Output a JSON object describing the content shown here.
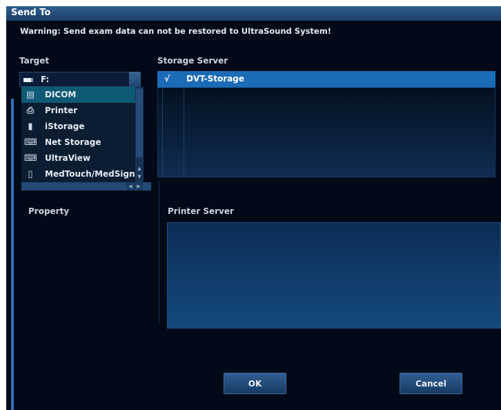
{
  "dialog": {
    "title": "Send To",
    "warning": "Warning: Send exam data can not be restored to UltraSound System!"
  },
  "target": {
    "label": "Target",
    "selected_value": "F:",
    "items": [
      {
        "label": "DICOM",
        "icon": "dicom-icon"
      },
      {
        "label": "Printer",
        "icon": "printer-icon"
      },
      {
        "label": "iStorage",
        "icon": "istorage-icon"
      },
      {
        "label": "Net Storage",
        "icon": "net-storage-icon"
      },
      {
        "label": "UltraView",
        "icon": "ultraview-icon"
      },
      {
        "label": "MedTouch/MedSign",
        "icon": "medtouch-icon"
      }
    ]
  },
  "storage_server": {
    "label": "Storage Server",
    "rows": [
      {
        "check": "√",
        "name": "DVT-Storage"
      }
    ]
  },
  "property": {
    "label": "Property"
  },
  "printer_server": {
    "label": "Printer Server"
  },
  "buttons": {
    "ok": "OK",
    "cancel": "Cancel"
  },
  "colors": {
    "title_bar": "#2f5e8f",
    "selection": "#1b6bb7",
    "background": "#020a18"
  }
}
